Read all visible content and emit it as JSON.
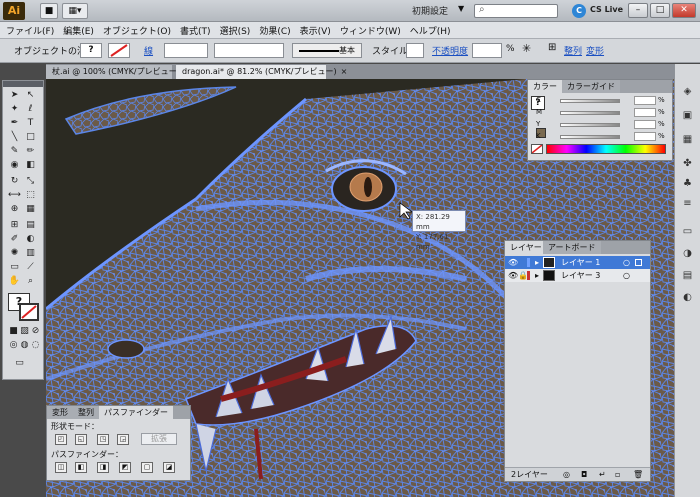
{
  "app": {
    "logo": "Ai"
  },
  "titlebar": {
    "workspace": "初期設定",
    "search_placeholder": "",
    "cslive": "CS Live",
    "window_buttons": {
      "minimize": "–",
      "restore": "□",
      "close": "✕"
    }
  },
  "menu": [
    "ファイル(F)",
    "編集(E)",
    "オブジェクト(O)",
    "書式(T)",
    "選択(S)",
    "効果(C)",
    "表示(V)",
    "ウィンドウ(W)",
    "ヘルプ(H)"
  ],
  "controlbar": {
    "selection_label": "オブジェクトの混在",
    "fill_q": "?",
    "stroke_label": "線",
    "stroke_style": "基本",
    "style_label": "スタイル",
    "opacity_label": "不透明度",
    "opacity_unit": "%",
    "align_label": "整列",
    "transform_label": "変形"
  },
  "tabs": {
    "tab1": "杖.ai @ 100% (CMYK/プレビュー)",
    "tab2": "dragon.ai* @ 81.2% (CMYK/プレビュー)",
    "close": "×"
  },
  "tooltip": {
    "x": "X: 281.29 mm",
    "y": "Y: 177.61 mm"
  },
  "color_panel": {
    "tab_color": "カラー",
    "tab_guide": "カラーガイド",
    "channels": [
      "C",
      "M",
      "Y",
      "K"
    ],
    "pct": "%"
  },
  "layers_panel": {
    "tab_layers": "レイヤー",
    "tab_artboard": "アートボード",
    "layers": [
      {
        "name": "レイヤー 1",
        "color": "#3f79d6",
        "selected": true
      },
      {
        "name": "レイヤー 3",
        "color": "#c93434",
        "selected": false
      }
    ],
    "footer": "2レイヤー"
  },
  "pathfinder": {
    "tab_transform": "変形",
    "tab_align": "整列",
    "tab_pathfinder": "パスファインダー",
    "shape_mode": "形状モード：",
    "pathfinder_label": "パスファインダー：",
    "expand": "拡張"
  },
  "colors": {
    "accent_path": "#5b86e8",
    "canvas": "#2b2a22",
    "dragon": "#6b5a48"
  }
}
